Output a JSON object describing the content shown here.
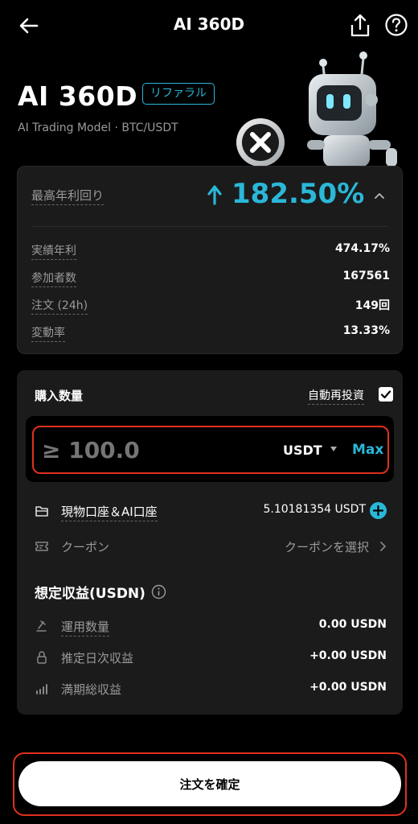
{
  "header": {
    "title": "AI 360D",
    "back_icon": "arrow-left-icon",
    "share_icon": "share-upload-icon",
    "help_icon": "question-circle-icon"
  },
  "hero": {
    "title": "AI 360D",
    "badge": "リファラル",
    "subtitle": "AI Trading Model · BTC/USDT"
  },
  "stats": {
    "max_yield_label": "最高年利回り",
    "max_yield_value": "182.50%",
    "rows": [
      {
        "label": "実績年利",
        "value": "474.17%"
      },
      {
        "label": "参加者数",
        "value": "167561"
      },
      {
        "label": "注文 (24h)",
        "value": "149回"
      },
      {
        "label": "変動率",
        "value": "13.33%"
      }
    ]
  },
  "order": {
    "quantity_label": "購入数量",
    "auto_reinvest_label": "自動再投資",
    "auto_reinvest_checked": true,
    "amount_placeholder": "≥ 100.0",
    "currency": "USDT",
    "max_label": "Max",
    "account_label": "現物口座＆AI口座",
    "account_balance": "5.10181354 USDT",
    "coupon_label": "クーポン",
    "coupon_select": "クーポンを選択",
    "estimate_title": "想定収益(USDN)",
    "estimates": [
      {
        "label": "運用数量",
        "value": "0.00 USDN"
      },
      {
        "label": "推定日次収益",
        "value": "+0.00 USDN"
      },
      {
        "label": "満期総収益",
        "value": "+0.00 USDN"
      }
    ]
  },
  "footer": {
    "confirm_label": "注文を確定"
  },
  "colors": {
    "accent": "#2ab7d8",
    "highlight_outline": "#e0301e",
    "card_bg": "#1b1b1b"
  }
}
